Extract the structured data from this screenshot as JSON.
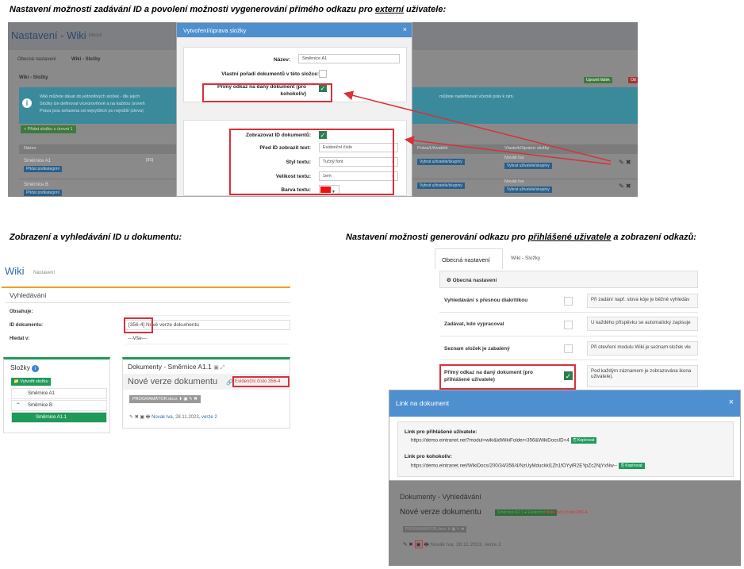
{
  "captions": {
    "c1": "Nastavení možnosti zadávání ID a povolení možnosti vygenerování přímého odkazu pro ",
    "c1u": "externí",
    "c1e": " uživatele:",
    "c2": "Zobrazení a vyhledávání ID u dokumentu:",
    "c3": "Nastavení možnosti generování odkazu pro ",
    "c3u": "přihlášené uživatele",
    "c3e": " a zobrazení odkazů:"
  },
  "s1": {
    "title": "Nastavení - Wiki",
    "title_small": "Modul",
    "tab1": "Obecná nastavení",
    "tab2": "Wiki - Složky",
    "section": "Wiki - Složky",
    "info1": "Wiki můžete dávat do jednotlivých složek - dle jejich",
    "info2": "Složky lze definovat víceúrovňově a na každou úroveň",
    "info3": "Práva jsou seřazena od nejvyšších po nejnižší (zleva)",
    "info4": "můžete nadefinovat včetně práv k nim.",
    "add": "+ Přidat složku v úrovni 1",
    "col1": "Název",
    "col2": "Práva/Uživatelé",
    "col3": "Vlastník/Správci složky",
    "btn_top1": "Upravit řádek",
    "btn_top2": "Od",
    "rows": [
      {
        "name": "Směrnice A1",
        "num": "[80]",
        "btn": "Přidat podkategorii",
        "btn2": "Vybrat uživatele/skupiny",
        "owner": "Novák Iva",
        "btn3": "Vybrat uživatele/skupiny"
      },
      {
        "name": "Směrnice B",
        "num": "",
        "btn": "Přidat podkategorii",
        "btn2": "Vybrat uživatele/skupiny",
        "owner": "Novák Iva",
        "btn3": "Vybrat uživatele/skupiny"
      }
    ]
  },
  "modal": {
    "title": "Vytvoření/úprava složky",
    "close": "×",
    "name_label": "Název:",
    "name_value": "Směrnice A1",
    "order_label": "Vlastní pořadí dokumentů v této složce:",
    "direct_label1": "Přímý odkaz na daný dokument (pro",
    "direct_label2": "kohokoliv)",
    "show_id_label": "Zobrazovat ID dokumentů:",
    "prefix_label": "Před ID zobrazit text:",
    "prefix_value": "Evidenční číslo",
    "style_label": "Styl textu:",
    "style_value": "Tučný font",
    "size_label": "Velikost textu:",
    "size_value": "1em",
    "color_label": "Barva textu:",
    "color_value": "#ee1111"
  },
  "s2": {
    "wiki": "Wiki",
    "nastaveni": "Nastavení",
    "search_title": "Vyhledávání",
    "contains": "Obsahuje:",
    "doc_id": "ID dokumentu:",
    "doc_id_val": "[356-4]",
    "doc_id_rest": " Nové verze dokumentu",
    "search_in": "Hledat v:",
    "search_in_val": "---Vše---",
    "folders": "Složky",
    "new_folder": "Vytvořit složku",
    "tree": [
      "Směrnice A1",
      "Směrnice B",
      "Směrnice A1.1"
    ],
    "docs_title": "Dokumenty - Směrnice A1.1",
    "doc_name": "Nové verze dokumentu",
    "evid": "Evidenční číslo 356-4",
    "file": "PROGRAMÁTOR.docx",
    "author": "Novak Iva",
    "date": ", 28.11.2023, ",
    "version": "verze 2"
  },
  "s3": {
    "tab1": "Obecná nastavení",
    "tab2": "Wiki - Složky",
    "section": "Obecná nastavení",
    "rows": [
      {
        "k": "Vyhledávání s přesnou diakritikou",
        "v": "Při zadání např. slova kóje je běžně vyhledáv",
        "on": false
      },
      {
        "k": "Zadávat, kdo vypracoval",
        "v": "U každého příspěvku se automaticky zapisuje",
        "on": false
      },
      {
        "k": "Seznam složek je zabalený",
        "v": "Při otevření modulu Wiki je seznam složek vle",
        "on": false
      },
      {
        "k": "Přímý odkaz na daný dokument (pro",
        "k2": "přihlášené uživatele)",
        "v": "Pod každým záznamem je zobrazována ikona",
        "v2": "uživatele).",
        "on": true
      }
    ]
  },
  "s4": {
    "title": "Link na dokument",
    "close": "×",
    "l1": "Link pro přihlášené uživatele:",
    "u1": "https://demo.eintranet.net?modul=wiki&idWikiFolder=356&WikiDocsID=4",
    "l2": "Link pro kohokoliv:",
    "u2": "https://demo.eintranet.net/WikiDocs/200/34/356/4/NzUyMduckkl1Zh1fOYylR2EYpZc2NjYxNw--",
    "copy": "Kopírovat",
    "docs": "Dokumenty - Vyhledávání",
    "docname": "Nové verze dokumentu",
    "badge": "Směrnice A1.1 ● Evidenční číslo",
    "evid": "Evidenční číslo 356-4",
    "file": "PROGRAMÁTOR.docx",
    "meta": "Novák Iva, 28.11.2023, verze 2"
  }
}
